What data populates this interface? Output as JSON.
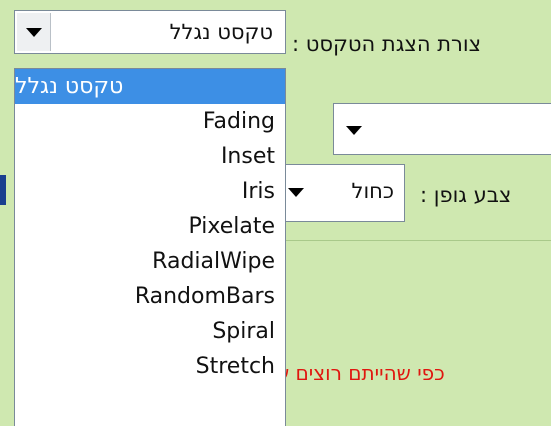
{
  "display_mode": {
    "label": "צורת הצגת הטקסט :",
    "selected": "טקסט נגלל",
    "options": [
      "טקסט נגלל",
      "Fading",
      "Inset",
      "Iris",
      "Pixelate",
      "RadialWipe",
      "RandomBars",
      "Spiral",
      "Stretch"
    ]
  },
  "font_color": {
    "label": "צבע גופן :",
    "selected": "כחול"
  },
  "fragments": {
    "bracket": "!",
    "red_text": "כפי שהייתם רוצים ש"
  },
  "colors": {
    "background": "#cfe8b0",
    "highlight": "#3d8fe5",
    "red_text": "#e0160f"
  }
}
